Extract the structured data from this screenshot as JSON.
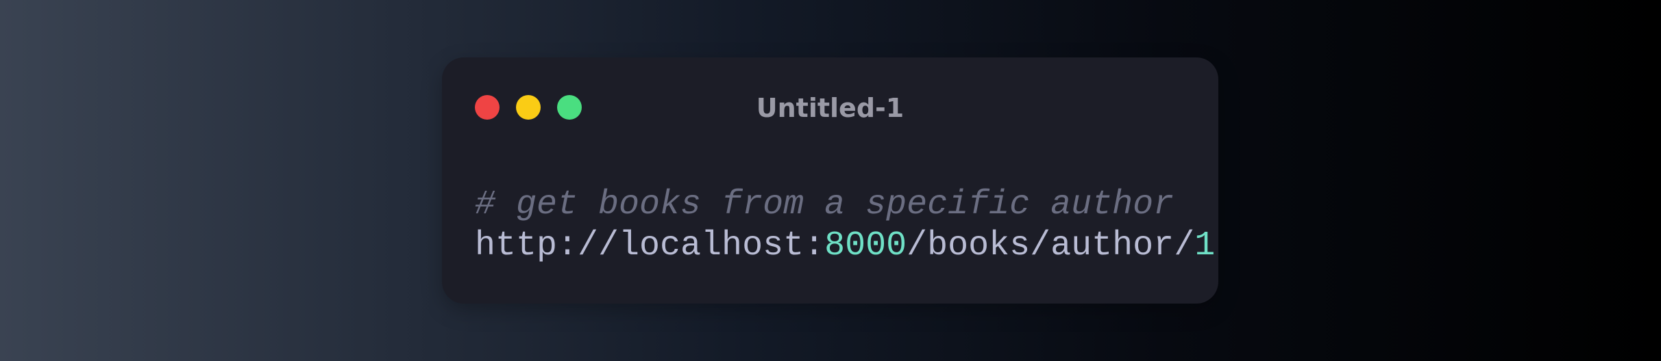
{
  "window": {
    "title": "Untitled-1",
    "controls": {
      "close_color": "#ef4444",
      "minimize_color": "#facc15",
      "maximize_color": "#4ade80"
    }
  },
  "code": {
    "comment": "# get books from a specific author",
    "url": {
      "scheme": "http://localhost:",
      "port": "8000",
      "path": "/books/author/",
      "id": "1"
    }
  },
  "colors": {
    "comment": "#6b6e82",
    "text": "#b9bcd4",
    "number": "#6fe0c6",
    "window_bg": "#1c1d27"
  }
}
